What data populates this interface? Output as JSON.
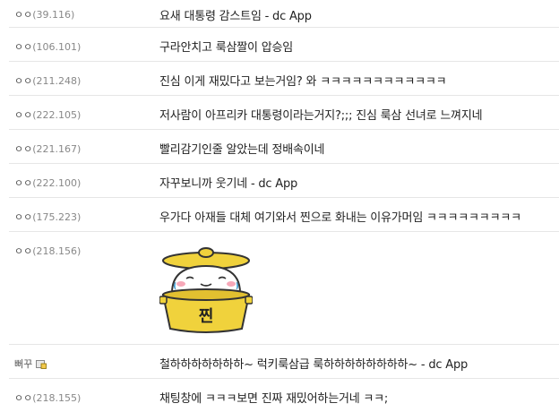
{
  "comments": [
    {
      "nick": "ㅇㅇ",
      "ip": "(39.116)",
      "text": "요새 대통령 감스트임 - dc App"
    },
    {
      "nick": "ㅇㅇ",
      "ip": "(106.101)",
      "text": "구라안치고 룩삼짤이 압승임"
    },
    {
      "nick": "ㅇㅇ",
      "ip": "(211.248)",
      "text": "진심 이게 재밌다고 보는거임? 와 ㅋㅋㅋㅋㅋㅋㅋㅋㅋㅋㅋㅋ"
    },
    {
      "nick": "ㅇㅇ",
      "ip": "(222.105)",
      "text": "저사람이 아프리카 대통령이라는거지?;;; 진심 룩삼 선녀로 느껴지네"
    },
    {
      "nick": "ㅇㅇ",
      "ip": "(221.167)",
      "text": "빨리감기인줄 알았는데 정배속이네"
    },
    {
      "nick": "ㅇㅇ",
      "ip": "(222.100)",
      "text": "자꾸보니까 웃기네 - dc App"
    },
    {
      "nick": "ㅇㅇ",
      "ip": "(175.223)",
      "text": "우가다 아재들 대체 여기와서 찐으로 화내는 이유가머임 ㅋㅋㅋㅋㅋㅋㅋㅋㅋ"
    },
    {
      "nick": "ㅇㅇ",
      "ip": "(218.156)",
      "sticker_text": "찐"
    },
    {
      "nick": "뻐꾸",
      "ip": "",
      "text": "철하하하하하하하~ 럭키룩삼급 룩하하하하하하하하~ - dc App"
    },
    {
      "nick": "ㅇㅇ",
      "ip": "(218.155)",
      "text": "채팅창에 ㅋㅋㅋ보면 진짜 재밌어하는거네 ㅋㅋ;"
    }
  ]
}
